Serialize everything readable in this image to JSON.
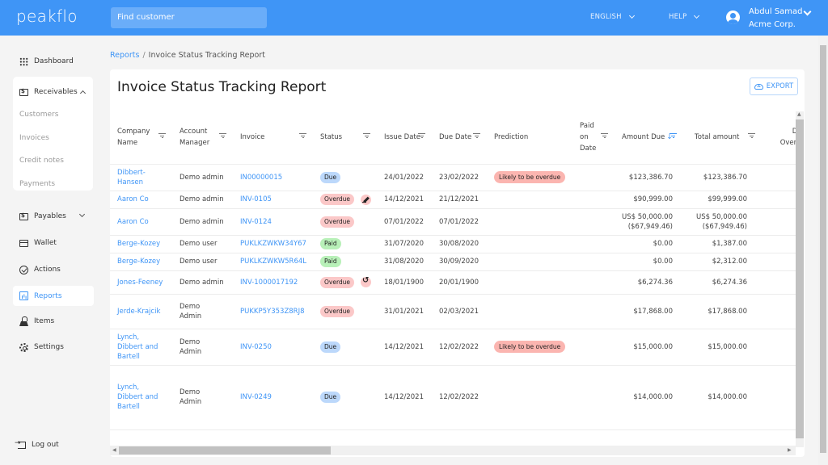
{
  "header": {
    "logo": "peakflo",
    "search_placeholder": "Find customer",
    "language": "ENGLISH",
    "help": "HELP",
    "user_name": "Abdul Samad",
    "user_org": "Acme Corp.",
    "brand_color": "#3f95f6"
  },
  "sidebar": {
    "dashboard": "Dashboard",
    "receivables": "Receivables",
    "receivables_sub": [
      "Customers",
      "Invoices",
      "Credit notes",
      "Payments"
    ],
    "payables": "Payables",
    "wallet": "Wallet",
    "actions": "Actions",
    "reports": "Reports",
    "items": "Items",
    "settings": "Settings",
    "logout": "Log out",
    "active": "Reports"
  },
  "breadcrumb": {
    "parent": "Reports",
    "separator": "/",
    "current": "Invoice Status Tracking Report"
  },
  "page": {
    "title": "Invoice Status Tracking Report",
    "export_label": "EXPORT"
  },
  "table": {
    "columns": [
      {
        "label": "Company Name",
        "filter": true
      },
      {
        "label": "Account Manager",
        "filter": true
      },
      {
        "label": "Invoice",
        "filter": true
      },
      {
        "label": "Status",
        "filter": true
      },
      {
        "label": "Issue Date",
        "filter": true
      },
      {
        "label": "Due Date",
        "filter": true
      },
      {
        "label": "Prediction",
        "filter": false
      },
      {
        "label": "Paid on Date",
        "filter": true
      },
      {
        "label": "Amount Due",
        "filter": true,
        "sorted": "desc"
      },
      {
        "label": "Total amount",
        "filter": true
      },
      {
        "label": "Days Overdue",
        "filter": false
      }
    ],
    "rows": [
      {
        "company": "Dibbert-Hansen",
        "manager": "Demo admin",
        "invoice": "IN00000015",
        "status": "Due",
        "flag": "",
        "issue": "24/01/2022",
        "due": "23/02/2022",
        "prediction": "Likely to be overdue",
        "paid_on": "",
        "amount_due": "$123,386.70",
        "amount_due_sub": "",
        "total": "$123,386.70",
        "total_sub": ""
      },
      {
        "company": "Aaron Co",
        "manager": "Demo admin",
        "invoice": "INV-0105",
        "status": "Overdue",
        "flag": "gavel",
        "issue": "14/12/2021",
        "due": "21/12/2021",
        "prediction": "",
        "paid_on": "",
        "amount_due": "$90,999.00",
        "amount_due_sub": "",
        "total": "$99,999.00",
        "total_sub": ""
      },
      {
        "company": "Aaron Co",
        "manager": "Demo admin",
        "invoice": "INV-0124",
        "status": "Overdue",
        "flag": "",
        "issue": "07/01/2022",
        "due": "07/01/2022",
        "prediction": "",
        "paid_on": "",
        "amount_due": "US$ 50,000.00",
        "amount_due_sub": "($67,949.46)",
        "total": "US$ 50,000.00",
        "total_sub": "($67,949.46)"
      },
      {
        "company": "Berge-Kozey",
        "manager": "Demo user",
        "invoice": "PUKLKZWKW34Y67",
        "status": "Paid",
        "flag": "",
        "issue": "31/07/2020",
        "due": "30/08/2020",
        "prediction": "",
        "paid_on": "",
        "amount_due": "$0.00",
        "amount_due_sub": "",
        "total": "$1,387.00",
        "total_sub": ""
      },
      {
        "company": "Berge-Kozey",
        "manager": "Demo user",
        "invoice": "PUKLKZWKW5R64L",
        "status": "Paid",
        "flag": "",
        "issue": "31/08/2020",
        "due": "30/09/2020",
        "prediction": "",
        "paid_on": "",
        "amount_due": "$0.00",
        "amount_due_sub": "",
        "total": "$2,312.00",
        "total_sub": ""
      },
      {
        "company": "Jones-Feeney",
        "manager": "Demo admin",
        "invoice": "INV-1000017192",
        "status": "Overdue",
        "flag": "refresh",
        "issue": "18/01/1900",
        "due": "20/01/1900",
        "prediction": "",
        "paid_on": "",
        "amount_due": "$6,274.36",
        "amount_due_sub": "",
        "total": "$6,274.36",
        "total_sub": ""
      },
      {
        "company": "Jerde-Krajcik",
        "manager": "Demo Admin",
        "invoice": "PUKKP5Y353Z8RJ8",
        "status": "Overdue",
        "flag": "",
        "issue": "31/01/2021",
        "due": "02/03/2021",
        "prediction": "",
        "paid_on": "",
        "amount_due": "$17,868.00",
        "amount_due_sub": "",
        "total": "$17,868.00",
        "total_sub": ""
      },
      {
        "company": "Lynch, Dibbert and Bartell",
        "manager": "Demo Admin",
        "invoice": "INV-0250",
        "status": "Due",
        "flag": "",
        "issue": "14/12/2021",
        "due": "12/02/2022",
        "prediction": "Likely to be overdue",
        "paid_on": "",
        "amount_due": "$15,000.00",
        "amount_due_sub": "",
        "total": "$15,000.00",
        "total_sub": ""
      },
      {
        "company": "Lynch, Dibbert and Bartell",
        "manager": "Demo Admin",
        "invoice": "INV-0249",
        "status": "Due",
        "flag": "",
        "issue": "14/12/2021",
        "due": "12/02/2022",
        "prediction": "",
        "paid_on": "",
        "amount_due": "$14,000.00",
        "amount_due_sub": "",
        "total": "$14,000.00",
        "total_sub": ""
      }
    ]
  }
}
